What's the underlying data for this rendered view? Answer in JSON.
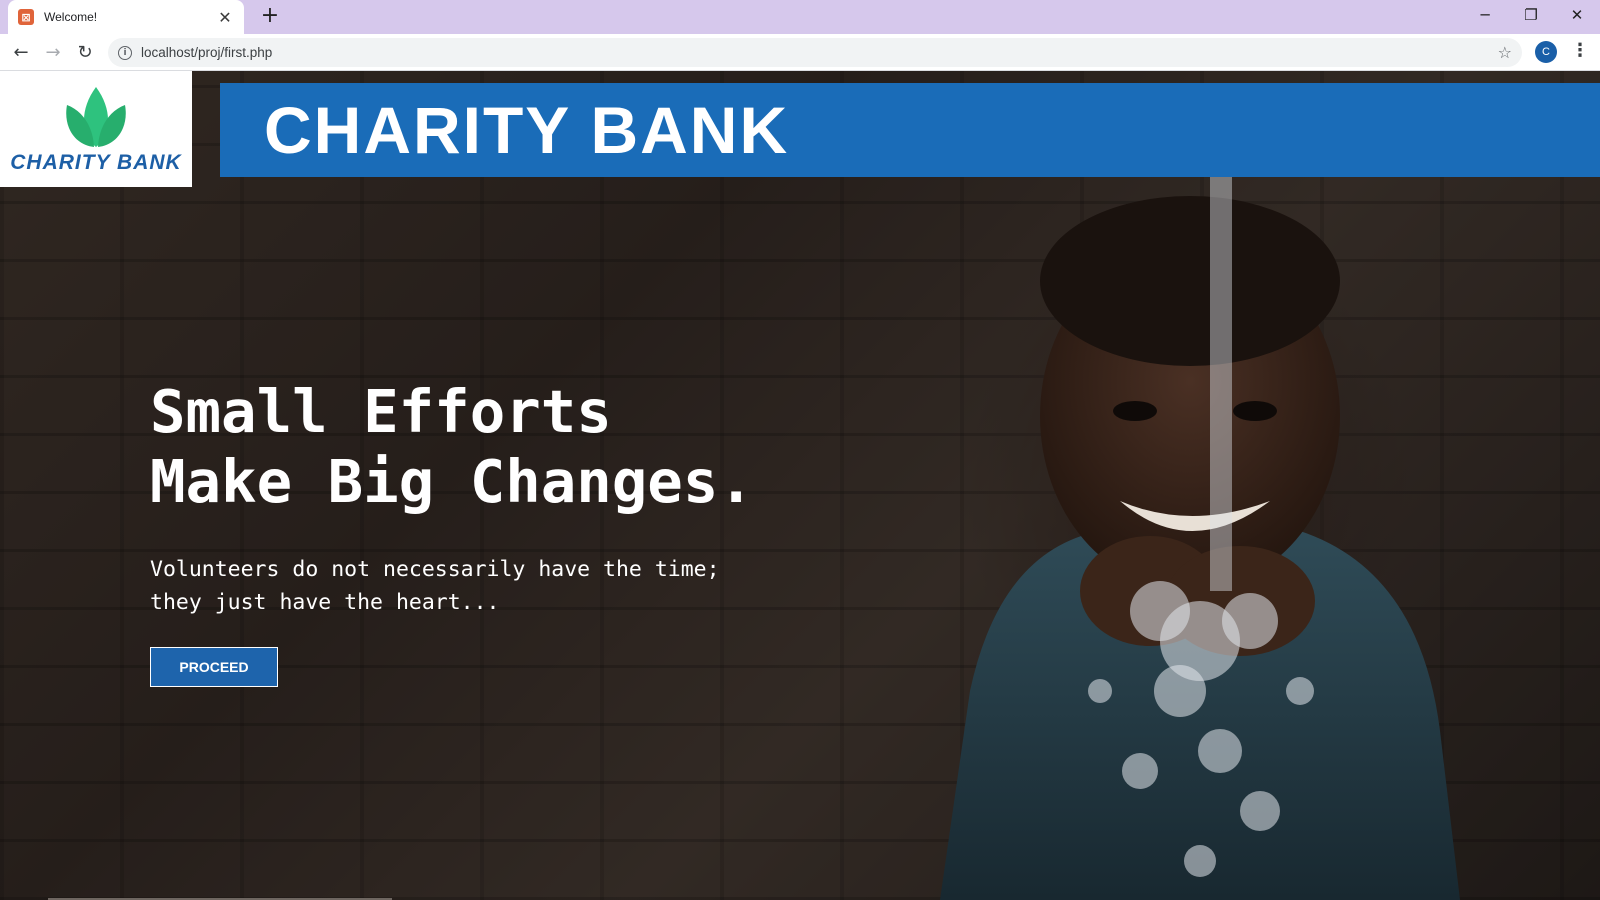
{
  "browser": {
    "tab": {
      "title": "Welcome!",
      "favicon": "xampp-icon"
    },
    "url": "localhost/proj/first.php",
    "profile_initial": "C",
    "icons": {
      "back": "arrow-left-icon",
      "forward": "arrow-right-icon",
      "reload": "reload-icon",
      "info": "info-icon",
      "bookmark": "star-icon",
      "menu": "kebab-menu-icon",
      "new_tab": "plus-icon",
      "minimize": "minimize-icon",
      "restore": "restore-icon",
      "close": "close-icon"
    }
  },
  "site": {
    "logo_text": "CHARITY BANK",
    "brand_title": "CHARITY BANK",
    "hero": {
      "headline_line1": "Small Efforts",
      "headline_line2": "Make Big Changes.",
      "sub_line1": "Volunteers do not necessarily have the time;",
      "sub_line2": "they just have the heart...",
      "button_label": "PROCEED"
    }
  },
  "colors": {
    "brand_blue": "#1a6cb8",
    "button_blue": "#1e64ac",
    "leaf_green": "#2ec27e",
    "titlebar": "#d6c8ec"
  }
}
